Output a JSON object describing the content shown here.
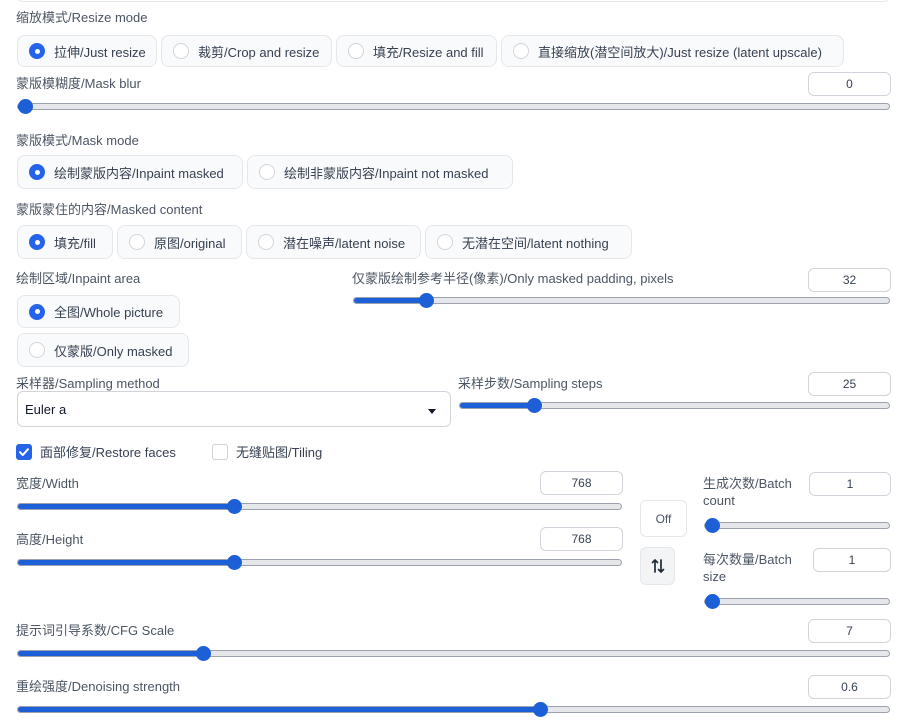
{
  "resize_mode": {
    "label": "缩放模式/Resize mode",
    "options": [
      "拉伸/Just resize",
      "裁剪/Crop and resize",
      "填充/Resize and fill",
      "直接缩放(潜空间放大)/Just resize (latent upscale)"
    ],
    "selected": 0
  },
  "mask_blur": {
    "label": "蒙版模糊度/Mask blur",
    "value": "0",
    "min": 0,
    "max": 64,
    "current": 0
  },
  "mask_mode": {
    "label": "蒙版模式/Mask mode",
    "options": [
      "绘制蒙版内容/Inpaint masked",
      "绘制非蒙版内容/Inpaint not masked"
    ],
    "selected": 0
  },
  "masked_content": {
    "label": "蒙版蒙住的内容/Masked content",
    "options": [
      "填充/fill",
      "原图/original",
      "潜在噪声/latent noise",
      "无潜在空间/latent nothing"
    ],
    "selected": 0
  },
  "inpaint_area": {
    "label": "绘制区域/Inpaint area",
    "options": [
      "全图/Whole picture",
      "仅蒙版/Only masked"
    ],
    "selected": 0
  },
  "only_masked_padding": {
    "label": "仅蒙版绘制参考半径(像素)/Only masked padding, pixels",
    "value": "32",
    "min": 0,
    "max": 256,
    "current": 32
  },
  "sampling_method": {
    "label": "采样器/Sampling method",
    "value": "Euler a"
  },
  "sampling_steps": {
    "label": "采样步数/Sampling steps",
    "value": "25",
    "min": 1,
    "max": 150,
    "current": 25
  },
  "restore_faces": {
    "label": "面部修复/Restore faces",
    "checked": true
  },
  "tiling": {
    "label": "无缝贴图/Tiling",
    "checked": false
  },
  "width": {
    "label": "宽度/Width",
    "value": "768",
    "min": 64,
    "max": 2048,
    "current": 768
  },
  "height": {
    "label": "高度/Height",
    "value": "768",
    "min": 64,
    "max": 2048,
    "current": 768
  },
  "off_button": {
    "label": "Off"
  },
  "swap_button": {
    "icon": "swap-vertical-icon"
  },
  "batch_count": {
    "label_line1": "生成次数/Batch",
    "label_line2": "count",
    "value": "1",
    "min": 1,
    "max": 100,
    "current": 1
  },
  "batch_size": {
    "label_line1": "每次数量/Batch",
    "label_line2": "size",
    "value": "1",
    "min": 1,
    "max": 8,
    "current": 1
  },
  "cfg_scale": {
    "label": "提示词引导系数/CFG Scale",
    "value": "7",
    "min": 1,
    "max": 30,
    "current": 7
  },
  "denoising_strength": {
    "label": "重绘强度/Denoising strength",
    "value": "0.6",
    "min": 0,
    "max": 1,
    "current": 0.6
  },
  "colors": {
    "accent": "#2563eb",
    "slider": "#1d5fd6",
    "track": "#e5e7eb"
  }
}
